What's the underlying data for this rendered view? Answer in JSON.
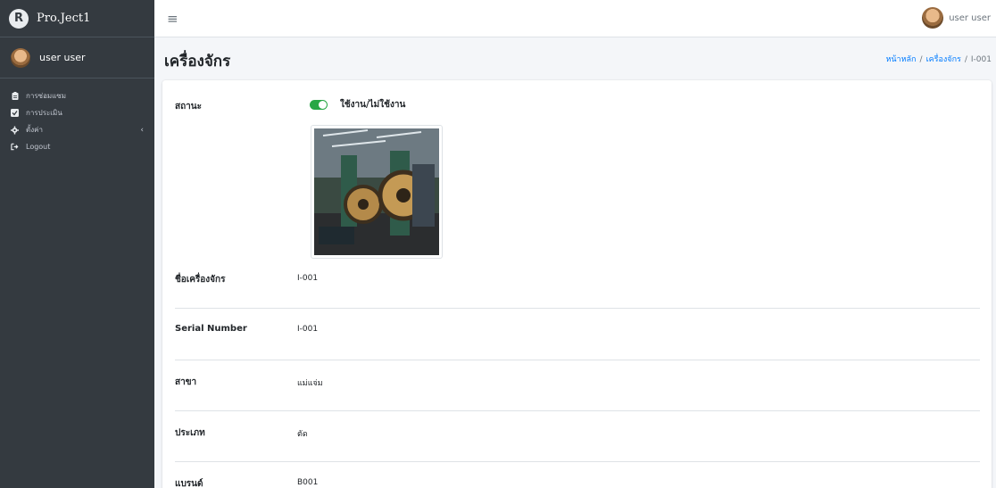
{
  "brand": {
    "name": "Pro.Ject1",
    "logo_letter": "R"
  },
  "sidebar": {
    "user_name": "user user",
    "items": [
      {
        "label": "การซ่อมแซม",
        "icon": "clipboard-icon"
      },
      {
        "label": "การประเมิน",
        "icon": "check-square-icon"
      },
      {
        "label": "ตั้งค่า",
        "icon": "cog-icon",
        "has_submenu": true
      },
      {
        "label": "Logout",
        "icon": "sign-out-icon"
      }
    ]
  },
  "topbar": {
    "menu_icon": "hamburger-icon",
    "user_name": "user user"
  },
  "header": {
    "title": "เครื่องจักร",
    "breadcrumb": [
      "หน้าหลัก",
      "เครื่องจักร",
      "I-001"
    ]
  },
  "detail": {
    "status_label": "สถานะ",
    "status_toggle_label": "ใช้งาน/ไม่ใช้งาน",
    "status_on": true,
    "fields": [
      {
        "label": "ชื่อเครื่องจักร",
        "value": "I-001"
      },
      {
        "label": "Serial Number",
        "value": "I-001"
      },
      {
        "label": "สาขา",
        "value": "แม่แจ่ม"
      },
      {
        "label": "ประเภท",
        "value": "ตัด"
      },
      {
        "label": "แบรนด์",
        "value": "B001"
      }
    ]
  },
  "colors": {
    "sidebar_bg": "#343a40",
    "accent": "#007bff",
    "toggle_on": "#28a745"
  }
}
